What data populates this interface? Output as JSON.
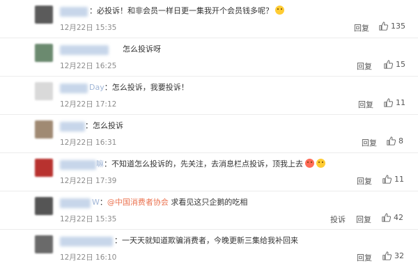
{
  "comments": [
    {
      "text": "：必投诉！和非会员一样日更一集我开个会员钱多呢？",
      "emoji_count": 1,
      "time": "12月22日 15:35",
      "actions": [
        "回复"
      ],
      "likes": "135",
      "avatar_color": "#5b5b5b"
    },
    {
      "text": "怎么投诉呀",
      "time": "12月22日 16:25",
      "actions": [
        "回复"
      ],
      "likes": "15",
      "avatar_color": "#6b8a6f"
    },
    {
      "name_visible": "Day",
      "text": "：怎么投诉，我要投诉！",
      "time": "12月22日 17:12",
      "actions": [
        "回复"
      ],
      "likes": "11",
      "avatar_color": "#d9d9d9"
    },
    {
      "text": "：怎么投诉",
      "time": "12月22日 16:31",
      "actions": [
        "回复"
      ],
      "likes": "8",
      "avatar_color": "#a08a73"
    },
    {
      "name_visible": "嘛",
      "text": "：不知道怎么投诉的，先关注，去消息栏点投诉，顶我上去",
      "emoji_count": 2,
      "time": "12月22日 17:39",
      "actions": [
        "回复"
      ],
      "likes": "11",
      "avatar_color": "#b8322f"
    },
    {
      "name_visible": "W",
      "mention": "@中国消费者协会",
      "text": " 求看见这只企鹅的吃相",
      "time": "12月22日 15:35",
      "actions": [
        "投诉",
        "回复"
      ],
      "likes": "42",
      "avatar_color": "#555555"
    },
    {
      "text": "：一天天就知道欺骗消费者，今晚更新三集给我补回来",
      "time": "12月22日 16:10",
      "actions": [
        "回复"
      ],
      "likes": "32",
      "avatar_color": "#6a6a6a"
    }
  ]
}
